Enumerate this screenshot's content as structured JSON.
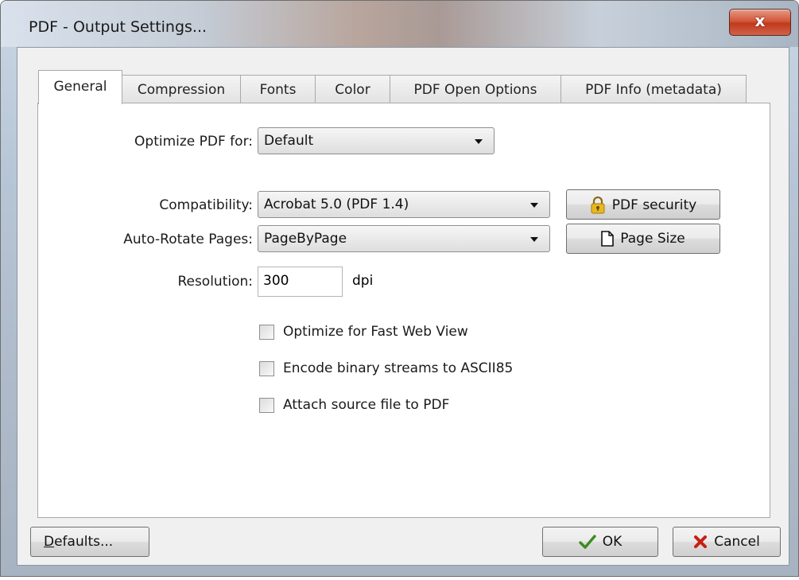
{
  "window": {
    "title": "PDF - Output Settings...",
    "close_label": "x"
  },
  "tabs": [
    {
      "label": "General",
      "active": true
    },
    {
      "label": "Compression"
    },
    {
      "label": "Fonts"
    },
    {
      "label": "Color"
    },
    {
      "label": "PDF Open Options"
    },
    {
      "label": "PDF Info (metadata)"
    }
  ],
  "general": {
    "optimize_label": "Optimize PDF for:",
    "optimize_value": "Default",
    "compat_label": "Compatibility:",
    "compat_value": "Acrobat 5.0 (PDF 1.4)",
    "rotate_label": "Auto-Rotate Pages:",
    "rotate_value": "PageByPage",
    "resolution_label": "Resolution:",
    "resolution_value": "300",
    "resolution_unit": "dpi",
    "security_button": "PDF security",
    "pagesize_button": "Page Size",
    "checkboxes": [
      {
        "label": "Optimize for Fast Web View",
        "checked": false
      },
      {
        "label": "Encode binary streams to ASCII85",
        "checked": false
      },
      {
        "label": "Attach source file to PDF",
        "checked": false
      }
    ]
  },
  "footer": {
    "defaults_mnemonic": "D",
    "defaults_rest": "efaults...",
    "ok_label": "OK",
    "cancel_label": "Cancel"
  },
  "icons": {
    "security": "lock-icon",
    "pagesize": "page-icon",
    "ok": "checkmark-icon",
    "cancel": "cross-icon"
  }
}
